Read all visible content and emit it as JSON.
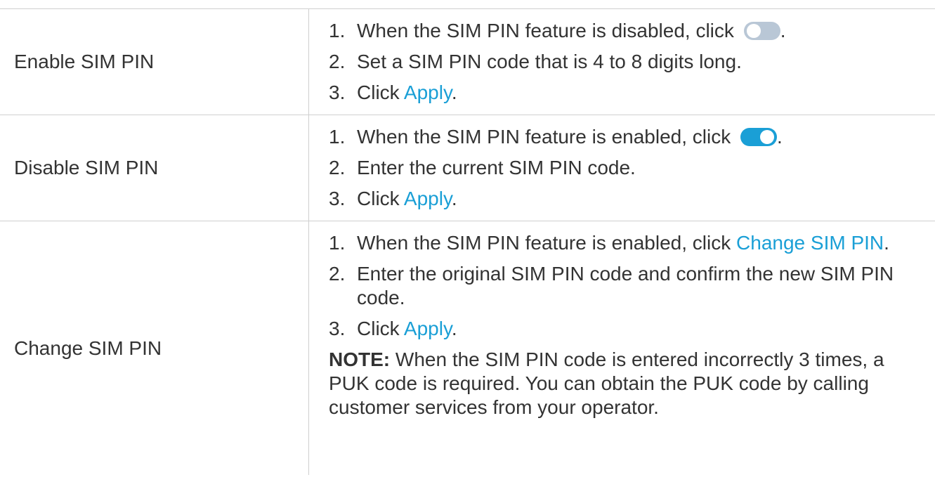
{
  "rows": [
    {
      "label": "Enable SIM PIN",
      "steps": [
        {
          "num": "1.",
          "text": "When the SIM PIN feature is disabled, click",
          "after": "."
        },
        {
          "num": "2.",
          "text": "Set a SIM PIN code that is 4 to 8 digits long."
        },
        {
          "num": "3.",
          "text": "Click",
          "link": "Apply",
          "after": "."
        }
      ],
      "toggle_state": "off"
    },
    {
      "label": "Disable SIM PIN",
      "steps": [
        {
          "num": "1.",
          "text": "When the SIM PIN feature is enabled, click",
          "after": "."
        },
        {
          "num": "2.",
          "text": "Enter the current SIM PIN code."
        },
        {
          "num": "3.",
          "text": "Click",
          "link": "Apply",
          "after": "."
        }
      ],
      "toggle_state": "on"
    },
    {
      "label": "Change SIM PIN",
      "steps": [
        {
          "num": "1.",
          "text": "When the SIM PIN feature is enabled, click",
          "link": "Change SIM PIN",
          "after": "."
        },
        {
          "num": "2.",
          "text": "Enter the original SIM PIN code and confirm the new SIM PIN code."
        },
        {
          "num": "3.",
          "text": "Click",
          "link": "Apply",
          "after": "."
        }
      ],
      "note_label": "NOTE:",
      "note_text": "When the SIM PIN code is entered incorrectly 3 times, a PUK code is required. You can obtain the PUK code by calling customer services from your operator."
    }
  ],
  "colors": {
    "link": "#1a9fd6",
    "toggle_on": "#1a9fd6",
    "toggle_off": "#b9c7d6",
    "border": "#cfcfcf",
    "text": "#333333"
  }
}
